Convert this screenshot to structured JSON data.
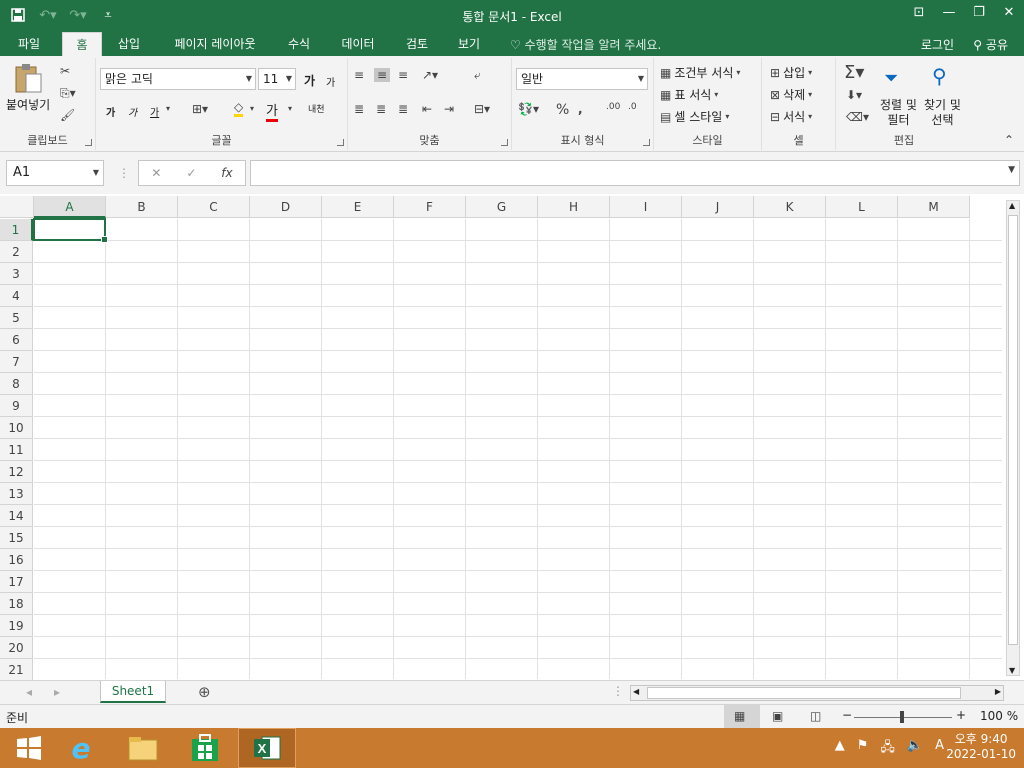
{
  "window": {
    "title": "통합 문서1 - Excel"
  },
  "tabs": [
    {
      "label": "파일"
    },
    {
      "label": "홈"
    },
    {
      "label": "삽입"
    },
    {
      "label": "페이지 레이아웃"
    },
    {
      "label": "수식"
    },
    {
      "label": "데이터"
    },
    {
      "label": "검토"
    },
    {
      "label": "보기"
    }
  ],
  "tell_me": "수행할 작업을 알려 주세요.",
  "login": "로그인",
  "share": "공유",
  "ribbon": {
    "clipboard": {
      "paste": "붙여넣기",
      "label": "클립보드"
    },
    "font": {
      "name": "맑은 고딕",
      "size": "11",
      "grow": "가",
      "shrink": "가",
      "bold": "가",
      "italic": "가",
      "underline": "가",
      "fontcolor": "가",
      "phonetic": "내천",
      "label": "글꼴"
    },
    "align": {
      "label": "맞춤"
    },
    "number": {
      "format": "일반",
      "label": "표시 형식"
    },
    "styles": {
      "cond": "조건부 서식",
      "table": "표 서식",
      "cell": "셀 스타일",
      "label": "스타일"
    },
    "cells": {
      "insert": "삽입",
      "delete": "삭제",
      "format": "서식",
      "label": "셀"
    },
    "edit": {
      "sort": "정렬 및",
      "sort2": "필터",
      "find": "찾기 및",
      "find2": "선택",
      "label": "편집"
    }
  },
  "namebox": "A1",
  "columns": [
    "A",
    "B",
    "C",
    "D",
    "E",
    "F",
    "G",
    "H",
    "I",
    "J",
    "K",
    "L",
    "M"
  ],
  "rows": [
    "1",
    "2",
    "3",
    "4",
    "5",
    "6",
    "7",
    "8",
    "9",
    "10",
    "11",
    "12",
    "13",
    "14",
    "15",
    "16",
    "17",
    "18",
    "19",
    "20",
    "21"
  ],
  "sheet_tab": "Sheet1",
  "status": {
    "ready": "준비",
    "zoom": "100 %"
  },
  "taskbar": {
    "time": "오후 9:40",
    "date": "2022-01-10",
    "ime": "A"
  },
  "colors": {
    "accent": "#217346"
  }
}
